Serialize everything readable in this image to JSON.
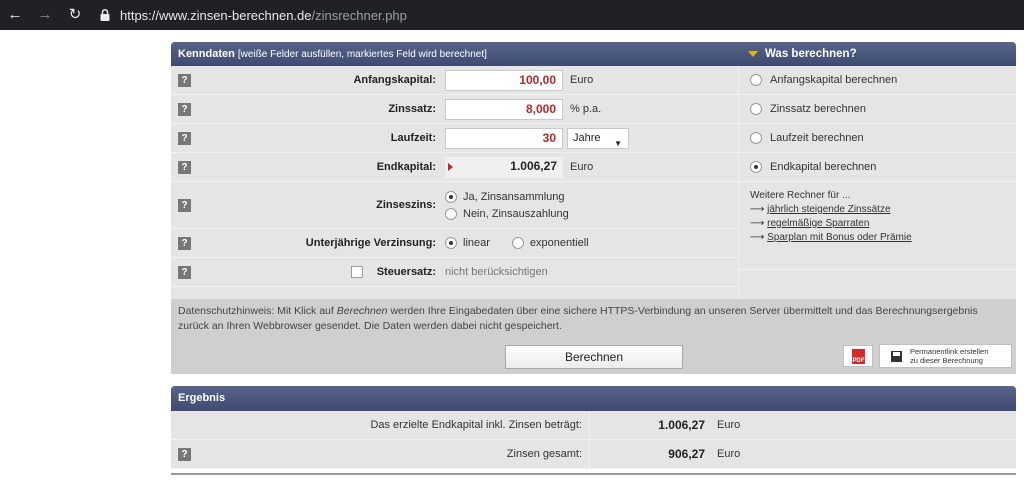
{
  "browser": {
    "url_domain": "https://www.zinsen-berechnen.de",
    "url_path": "/zinsrechner.php"
  },
  "header": {
    "title": "Kenndaten",
    "subtitle": "[weiße Felder ausfüllen, markiertes Feld wird berechnet]",
    "right_title": "Was berechnen?"
  },
  "help_label": "?",
  "fields": {
    "anfangskapital": {
      "label": "Anfangskapital:",
      "value": "100,00",
      "unit": "Euro"
    },
    "zinssatz": {
      "label": "Zinssatz:",
      "value": "8,000",
      "unit": "% p.a."
    },
    "laufzeit": {
      "label": "Laufzeit:",
      "value": "30",
      "unit_select": "Jahre"
    },
    "endkapital": {
      "label": "Endkapital:",
      "value": "1.006,27",
      "unit": "Euro"
    },
    "zinseszins": {
      "label": "Zinseszins:",
      "option_yes": "Ja, Zinsansammlung",
      "option_no": "Nein, Zinsauszahlung"
    },
    "unterjaehrig": {
      "label": "Unterjährige Verzinsung:",
      "option_linear": "linear",
      "option_exp": "exponentiell"
    },
    "steuersatz": {
      "label": "Steuersatz:",
      "value": "nicht berücksichtigen"
    }
  },
  "calc_options": {
    "anfangskapital": "Anfangskapital berechnen",
    "zinssatz": "Zinssatz berechnen",
    "laufzeit": "Laufzeit berechnen",
    "endkapital": "Endkapital berechnen"
  },
  "more": {
    "title": "Weitere Rechner für ...",
    "arrow": "⟶",
    "link1": "jährlich steigende Zinssätze",
    "link2": "regelmäßige Sparraten",
    "link3": "Sparplan mit Bonus oder Prämie"
  },
  "privacy": {
    "before": "Datenschutzhinweis: Mit Klick auf ",
    "em": "Berechnen",
    "after": " werden Ihre Eingabedaten über eine sichere HTTPS-Verbindung an unseren Server übermittelt und das Berechnungsergebnis zurück an Ihren Webbrowser gesendet. Die Daten werden dabei nicht gespeichert."
  },
  "buttons": {
    "berechnen": "Berechnen",
    "pdf": "PDF",
    "permalink_line1": "Permanentlink erstellen",
    "permalink_line2": "zu dieser Berechnung"
  },
  "result": {
    "title": "Ergebnis",
    "row1_label": "Das erzielte Endkapital inkl. Zinsen beträgt:",
    "row1_value": "1.006,27",
    "row1_unit": "Euro",
    "row2_label": "Zinsen gesamt:",
    "row2_value": "906,27",
    "row2_unit": "Euro"
  }
}
